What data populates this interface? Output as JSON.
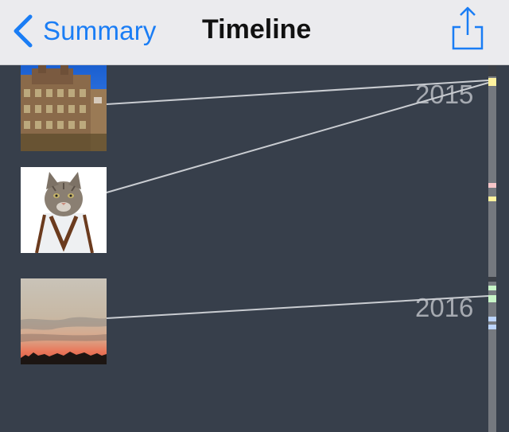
{
  "navbar": {
    "back_label": "Summary",
    "title": "Timeline",
    "accent": "#1a7df5"
  },
  "timeline": {
    "years": [
      "2015",
      "2016"
    ],
    "photos": [
      {
        "subject": "building"
      },
      {
        "subject": "cat-in-robe"
      },
      {
        "subject": "sunset"
      }
    ],
    "scrubber": {
      "marker_colors": [
        "#fff29e",
        "#f7c6c9",
        "#fff29e",
        "#c8f5c8",
        "#bcd5ff"
      ]
    }
  }
}
